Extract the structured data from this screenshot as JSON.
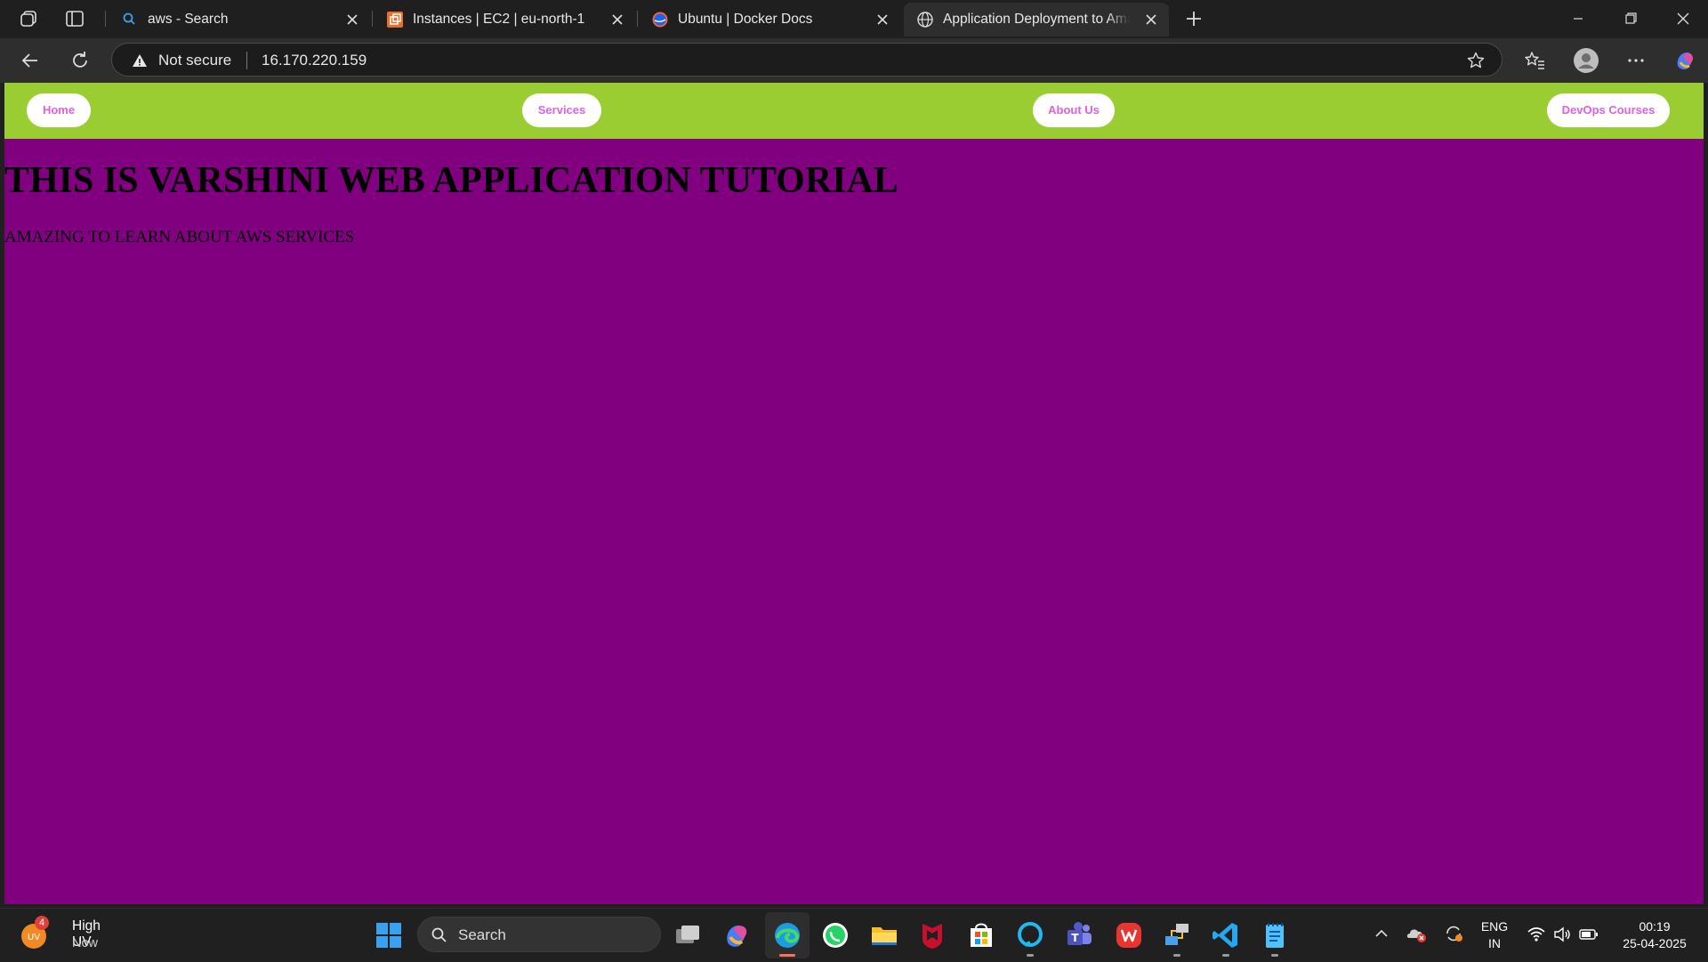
{
  "browser": {
    "tabs": [
      {
        "title": "aws - Search",
        "favicon": "bing-search-icon",
        "active": false
      },
      {
        "title": "Instances | EC2 | eu-north-1",
        "favicon": "aws-ec2-icon",
        "active": false
      },
      {
        "title": "Ubuntu | Docker Docs",
        "favicon": "docker-icon",
        "active": false
      },
      {
        "title": "Application Deployment to Amazon",
        "favicon": "globe-icon",
        "active": true
      }
    ],
    "address_bar": {
      "security_label": "Not secure",
      "url": "16.170.220.159"
    }
  },
  "page": {
    "nav": [
      "Home",
      "Services",
      "About Us",
      "DevOps Courses"
    ],
    "heading": "THIS IS VARSHINI WEB APPLICATION TUTORIAL",
    "paragraph": "AMAZING TO LEARN ABOUT AWS SERVICES",
    "colors": {
      "background": "#800080",
      "navbar": "#9acd32",
      "nav_text": "#e060e0"
    }
  },
  "taskbar": {
    "weather": {
      "title": "High UV",
      "subtitle": "Now",
      "badge": "4",
      "badge_icon": "UV"
    },
    "search_label": "Search",
    "apps": [
      "task-view-icon",
      "copilot-icon",
      "edge-icon",
      "whatsapp-icon",
      "file-explorer-icon",
      "mcafee-icon",
      "microsoft-store-icon",
      "alexa-icon",
      "teams-icon",
      "wps-office-icon",
      "network-tool-icon",
      "vscode-icon",
      "notepad-icon"
    ],
    "tray": {
      "language_line1": "ENG",
      "language_line2": "IN",
      "time": "00:19",
      "date": "25-04-2025"
    }
  }
}
